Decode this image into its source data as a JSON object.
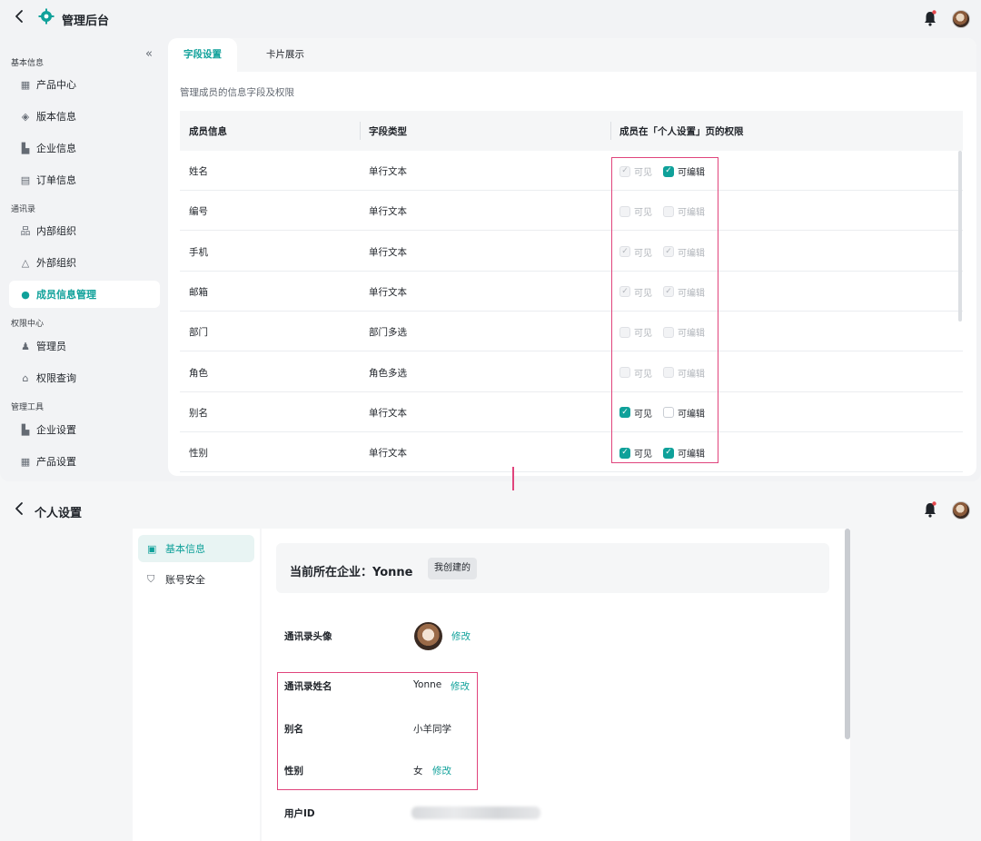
{
  "admin": {
    "title": "管理后台",
    "sections": [
      {
        "label": "基本信息",
        "items": [
          {
            "label": "产品中心",
            "icon": "grid-icon"
          },
          {
            "label": "版本信息",
            "icon": "layers-icon"
          },
          {
            "label": "企业信息",
            "icon": "building-icon"
          },
          {
            "label": "订单信息",
            "icon": "document-icon"
          }
        ]
      },
      {
        "label": "通讯录",
        "items": [
          {
            "label": "内部组织",
            "icon": "org-chart-icon"
          },
          {
            "label": "外部组织",
            "icon": "external-org-icon"
          },
          {
            "label": "成员信息管理",
            "icon": "member-icon",
            "active": true
          }
        ]
      },
      {
        "label": "权限中心",
        "items": [
          {
            "label": "管理员",
            "icon": "admin-user-icon"
          },
          {
            "label": "权限查询",
            "icon": "lock-icon"
          }
        ]
      },
      {
        "label": "管理工具",
        "items": [
          {
            "label": "企业设置",
            "icon": "building-settings-icon"
          },
          {
            "label": "产品设置",
            "icon": "grid-settings-icon"
          }
        ]
      }
    ],
    "tabs": [
      "字段设置",
      "卡片展示"
    ],
    "description": "管理成员的信息字段及权限",
    "columns": [
      "成员信息",
      "字段类型",
      "成员在「个人设置」页的权限"
    ],
    "perm_labels": {
      "visible": "可见",
      "editable": "可编辑"
    },
    "rows": [
      {
        "name": "姓名",
        "type": "单行文本",
        "visible": "checked-disabled",
        "editable": "checked"
      },
      {
        "name": "编号",
        "type": "单行文本",
        "visible": "unchecked-disabled",
        "editable": "unchecked-disabled"
      },
      {
        "name": "手机",
        "type": "单行文本",
        "visible": "checked-disabled",
        "editable": "checked-disabled"
      },
      {
        "name": "邮箱",
        "type": "单行文本",
        "visible": "checked-disabled",
        "editable": "checked-disabled"
      },
      {
        "name": "部门",
        "type": "部门多选",
        "visible": "unchecked-disabled",
        "editable": "unchecked-disabled"
      },
      {
        "name": "角色",
        "type": "角色多选",
        "visible": "unchecked-disabled",
        "editable": "unchecked-disabled"
      },
      {
        "name": "别名",
        "type": "单行文本",
        "visible": "checked",
        "editable": "unchecked"
      },
      {
        "name": "性别",
        "type": "单行文本",
        "visible": "checked",
        "editable": "checked"
      }
    ]
  },
  "personal": {
    "title": "个人设置",
    "menu": [
      {
        "label": "基本信息",
        "icon": "profile-card-icon",
        "active": true
      },
      {
        "label": "账号安全",
        "icon": "shield-icon"
      }
    ],
    "company_label": "当前所在企业：Yonne",
    "company_tag": "我创建的",
    "fields": {
      "avatar_label": "通讯录头像",
      "avatar_edit": "修改",
      "name_label": "通讯录姓名",
      "name_value": "Yonne",
      "name_edit": "修改",
      "alias_label": "别名",
      "alias_value": "小羊同学",
      "gender_label": "性别",
      "gender_value": "女",
      "gender_edit": "修改",
      "userid_label": "用户ID"
    }
  },
  "colors": {
    "accent": "#0fa19a",
    "highlight": "#e0447c"
  }
}
